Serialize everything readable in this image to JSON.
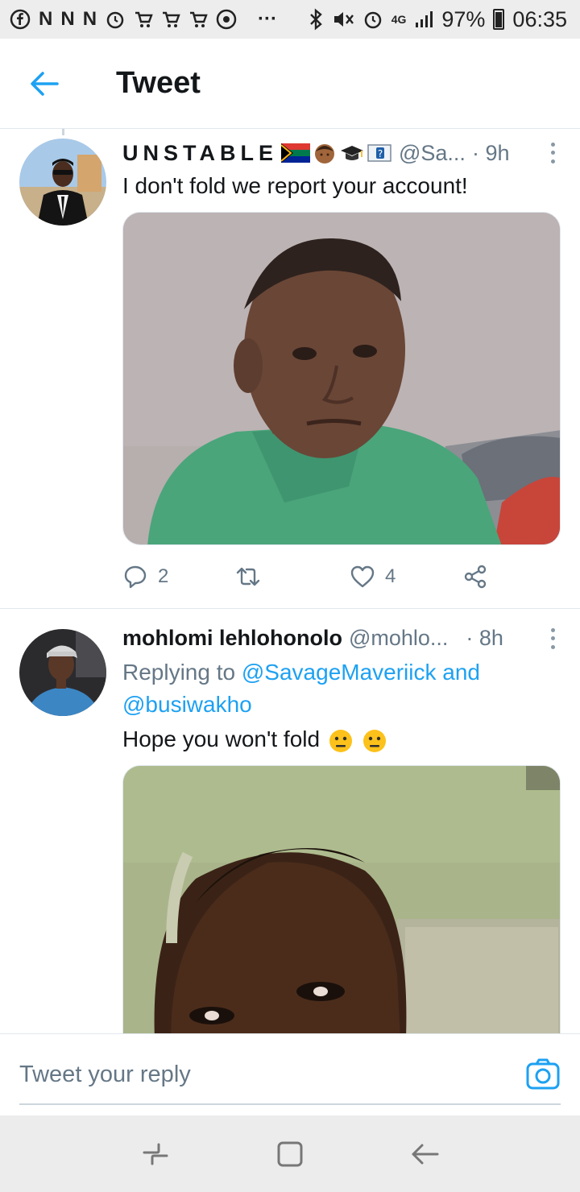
{
  "status_bar": {
    "battery": "97%",
    "time": "06:35",
    "network": "4G",
    "left_icons": [
      "facebook-icon",
      "n-icon",
      "n-icon",
      "n-icon",
      "alarm-icon",
      "cart-icon",
      "cart-icon",
      "cart-icon",
      "chrome-icon",
      "more-icon"
    ]
  },
  "header": {
    "title": "Tweet"
  },
  "tweets": [
    {
      "display_name": "UNSTABLE",
      "handle": "@Sa...",
      "time": "· 9h",
      "text": "I don't fold we report your account!",
      "actions": {
        "replies": "2",
        "retweets": "",
        "likes": "4"
      }
    },
    {
      "display_name": "mohlomi lehlohonolo",
      "handle": "@mohlo...",
      "time": "· 8h",
      "replying_prefix": "Replying to ",
      "replying_user1": "@SavageMaveriick",
      "replying_and": " and",
      "replying_user2": "@busiwakho",
      "text": "Hope you won't fold "
    }
  ],
  "reply_bar": {
    "placeholder": "Tweet your reply"
  },
  "colors": {
    "accent": "#1da1f2",
    "secondary_text": "#657786",
    "divider": "#e1e8ed"
  }
}
